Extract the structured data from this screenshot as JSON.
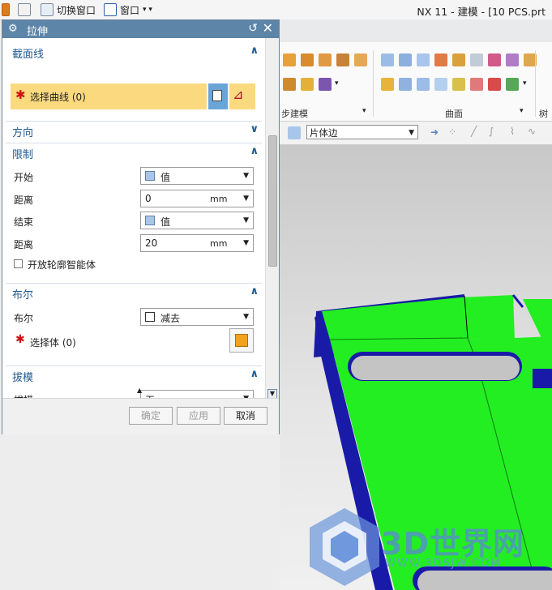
{
  "titlebar": {
    "switch_window": "切换窗口",
    "window_menu": "窗口",
    "app_title": "NX 11 - 建模 - [10 PCS.prt"
  },
  "ribbon": {
    "group_left_label": "步建模",
    "group_surface_label": "曲面",
    "group_right_label": "树"
  },
  "selection_bar": {
    "filter_value": "片体边"
  },
  "dialog": {
    "title": "拉伸",
    "sections": {
      "section": {
        "label": "截面线",
        "select_curve": "选择曲线 (0)"
      },
      "direction": {
        "label": "方向"
      },
      "limits": {
        "label": "限制",
        "start_label": "开始",
        "start_value": "值",
        "start_distance_label": "距离",
        "start_distance_value": "0",
        "start_distance_unit": "mm",
        "end_label": "结束",
        "end_value": "值",
        "end_distance_label": "距离",
        "end_distance_value": "20",
        "end_distance_unit": "mm",
        "open_profile": "开放轮廓智能体"
      },
      "boolean": {
        "label": "布尔",
        "bool_label": "布尔",
        "bool_value": "减去",
        "select_body": "选择体 (0)"
      },
      "draft": {
        "label": "拔模",
        "draft_label": "拔模",
        "draft_value": "无"
      }
    },
    "buttons": {
      "ok": "确定",
      "apply": "应用",
      "cancel": "取消"
    }
  },
  "watermark": {
    "brand": "3D世界网",
    "url": "WWW.3DSJW.COM"
  },
  "colors": {
    "title_bar": "#5d85a8",
    "section_text": "#1f5a8f",
    "highlight": "#fbd97f",
    "model_face": "#22ee22",
    "model_side": "#1a1aa8"
  }
}
